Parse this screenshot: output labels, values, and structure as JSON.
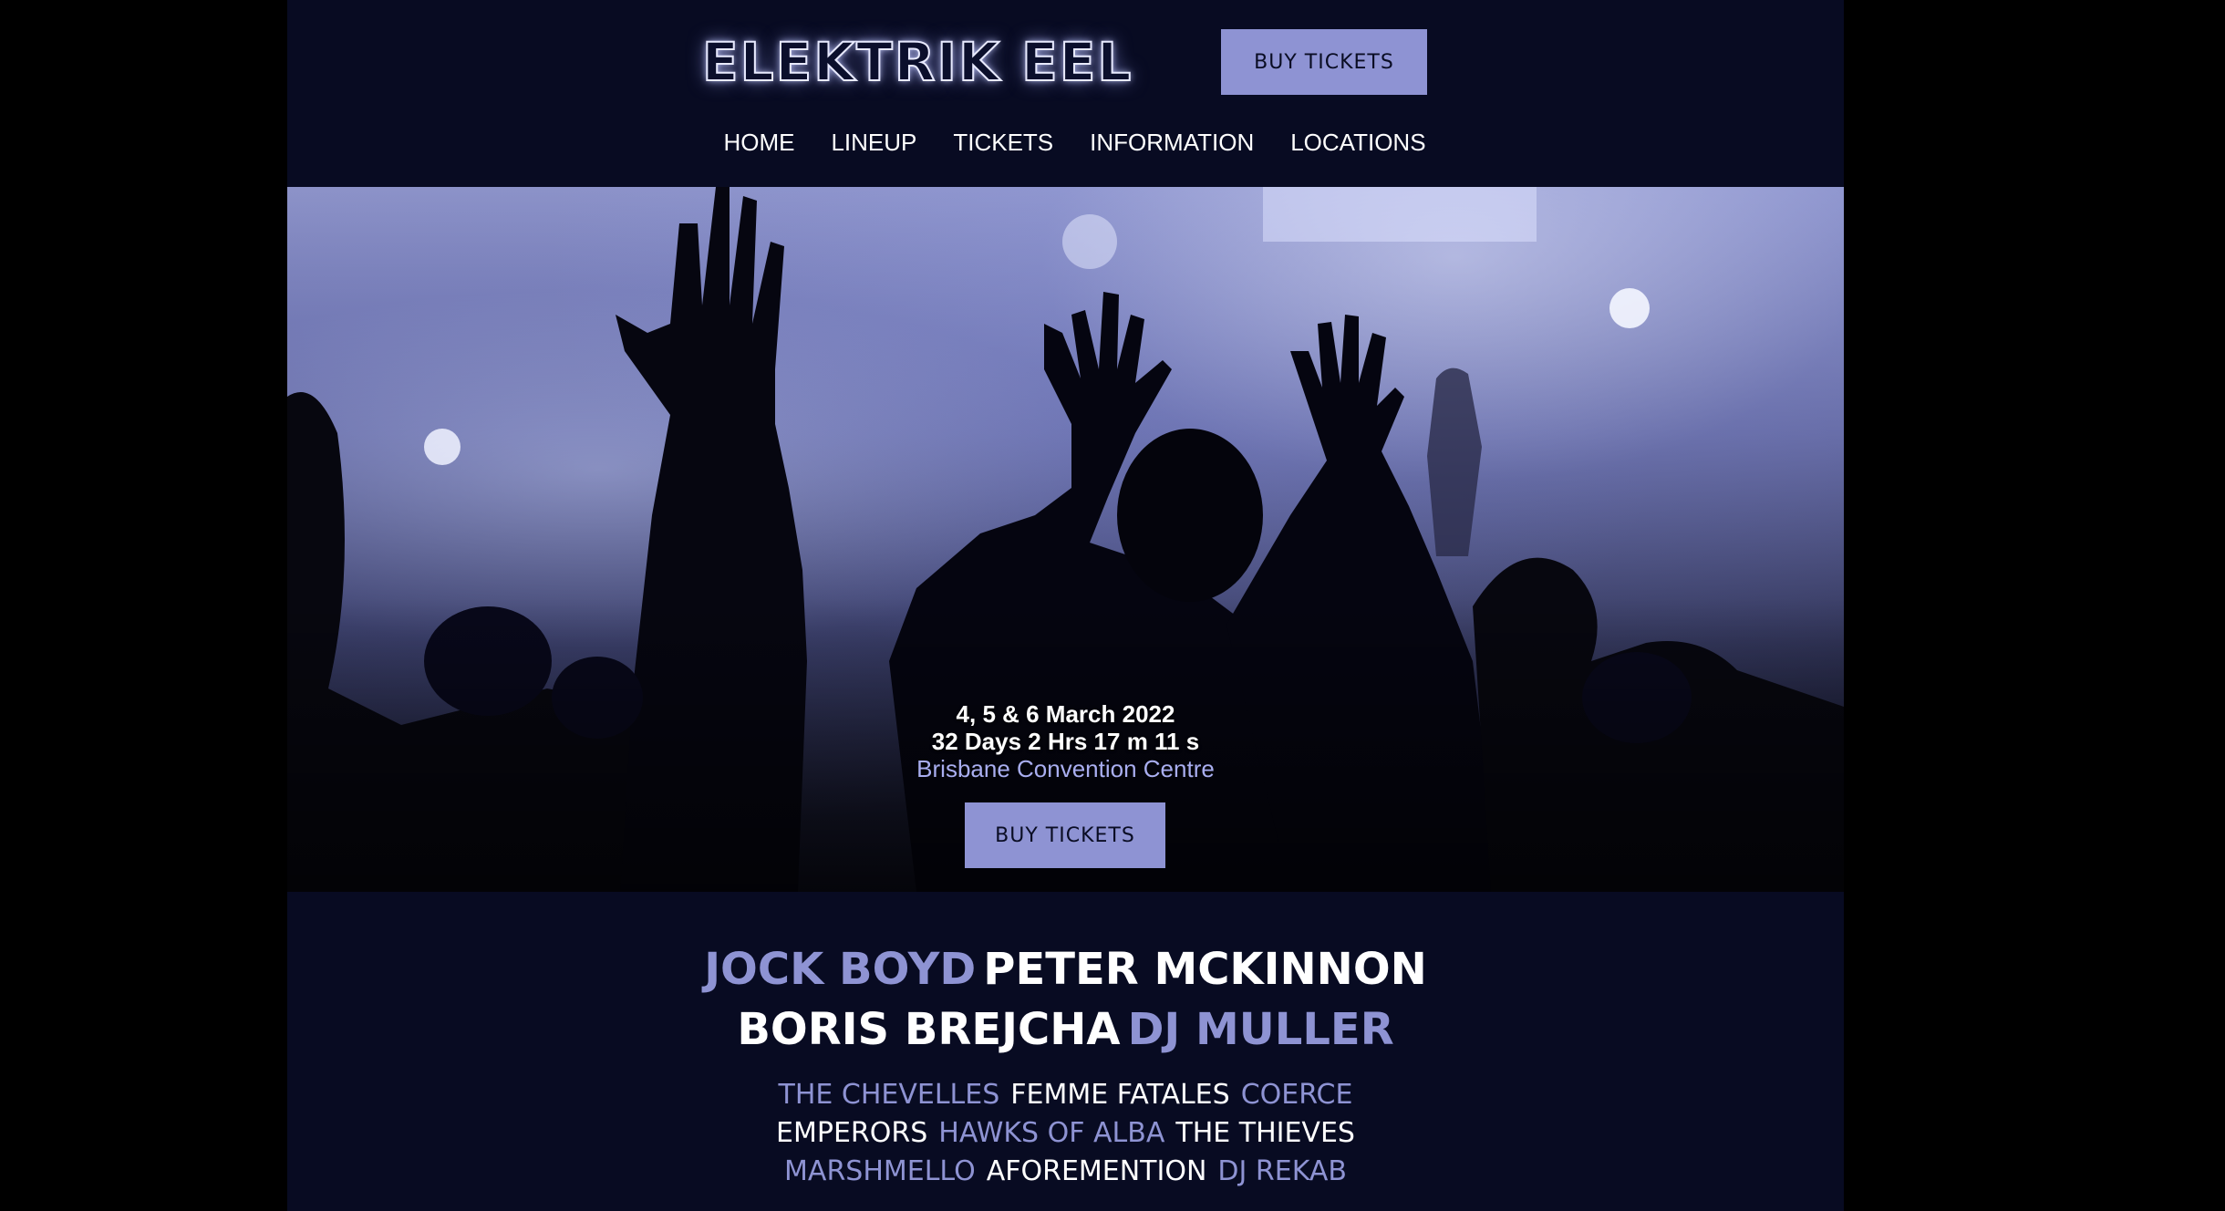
{
  "header": {
    "logo": "ELEKTRIK EEL",
    "buy_tickets": "BUY TICKETS"
  },
  "nav": {
    "items": [
      "HOME",
      "LINEUP",
      "TICKETS",
      "INFORMATION",
      "LOCATIONS"
    ]
  },
  "hero": {
    "dates": "4, 5 & 6 March 2022",
    "countdown": "32 Days 2 Hrs 17 m 11 s",
    "venue": "Brisbane Convention Centre",
    "buy_tickets": "BUY TICKETS"
  },
  "lineup": {
    "headliners": [
      [
        "JOCK BOYD",
        "PETER MCKINNON"
      ],
      [
        "BORIS BREJCHA",
        "DJ MULLER"
      ]
    ],
    "support": [
      [
        "THE CHEVELLES",
        "FEMME FATALES",
        "COERCE"
      ],
      [
        "EMPERORS",
        "HAWKS OF ALBA",
        "THE THIEVES"
      ],
      [
        "MARSHMELLO",
        "AFOREMENTION",
        "DJ REKAB"
      ]
    ]
  },
  "colors": {
    "page_bg": "#080b22",
    "accent": "#8e93d3",
    "text": "#ffffff",
    "outer_bg": "#000000"
  }
}
